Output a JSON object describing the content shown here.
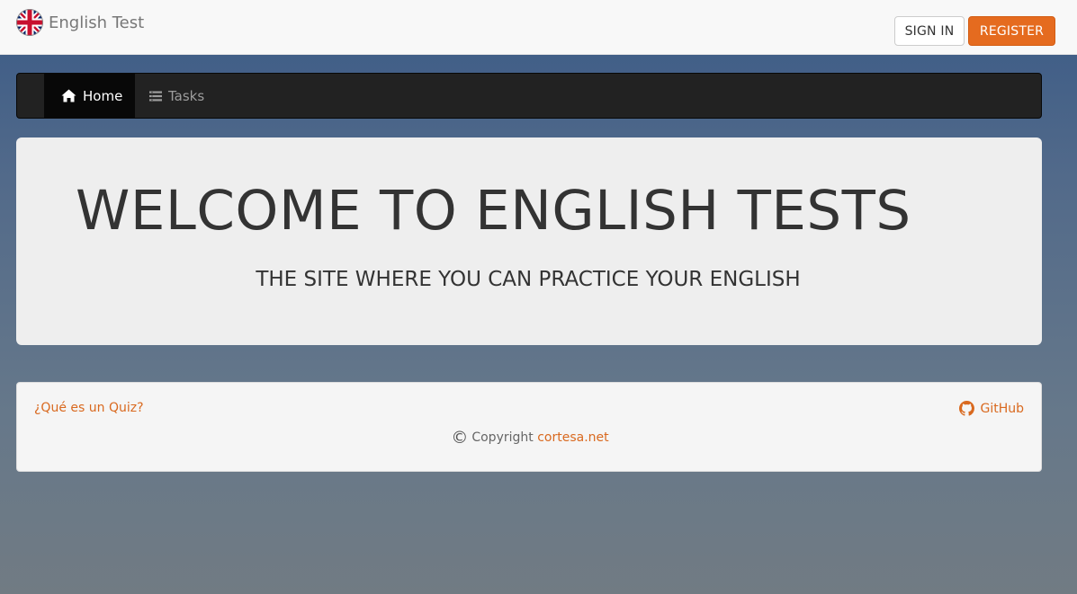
{
  "header": {
    "brand_title": "English Test",
    "signin_label": "SIGN IN",
    "register_label": "REGISTER",
    "accent_color": "#e56b1f"
  },
  "nav": {
    "items": [
      {
        "label": "Home",
        "icon": "home-icon",
        "active": true
      },
      {
        "label": "Tasks",
        "icon": "list-icon",
        "active": false
      }
    ]
  },
  "jumbotron": {
    "title": "WELCOME TO ENGLISH TESTS",
    "subtitle": "THE SITE WHERE YOU CAN PRACTICE YOUR ENGLISH"
  },
  "footer": {
    "quiz_link": "¿Qué es un Quiz?",
    "github_link": "GitHub",
    "copyright_text": "Copyright",
    "copyright_link": "cortesa.net",
    "link_color": "#d9691f"
  }
}
